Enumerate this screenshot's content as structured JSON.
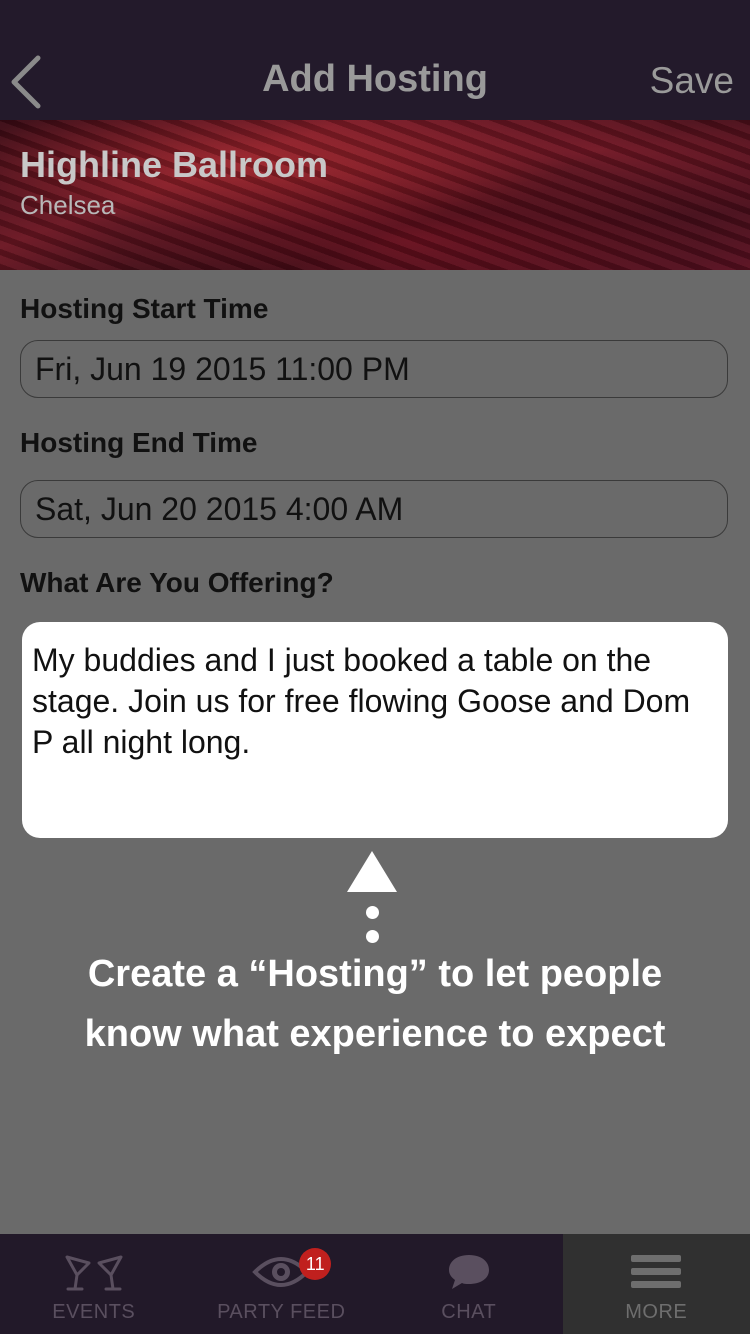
{
  "nav": {
    "title": "Add Hosting",
    "save_label": "Save",
    "back_icon": "chevron-left-icon"
  },
  "venue": {
    "name": "Highline Ballroom",
    "area": "Chelsea"
  },
  "form": {
    "start_label": "Hosting Start Time",
    "start_value": "Fri, Jun 19 2015 11:00 PM",
    "end_label": "Hosting End Time",
    "end_value": "Sat, Jun 20 2015 4:00 AM",
    "offer_label": "What Are You Offering?",
    "offer_value": "My buddies and I just booked a table on the stage. Join us for free flowing Goose and Dom P all night long."
  },
  "callout": {
    "line1": "Create a “Hosting” to let people",
    "line2": "know what experience to expect"
  },
  "tabs": [
    {
      "label": "EVENTS",
      "icon": "cocktail-glasses-icon"
    },
    {
      "label": "PARTY FEED",
      "icon": "eye-icon",
      "badge": "11"
    },
    {
      "label": "CHAT",
      "icon": "chat-bubble-icon"
    },
    {
      "label": "MORE",
      "icon": "menu-icon",
      "active": true
    }
  ],
  "colors": {
    "navbar": "#231a2b",
    "badge": "#c0201e",
    "overlay": "#6a6a6a"
  }
}
